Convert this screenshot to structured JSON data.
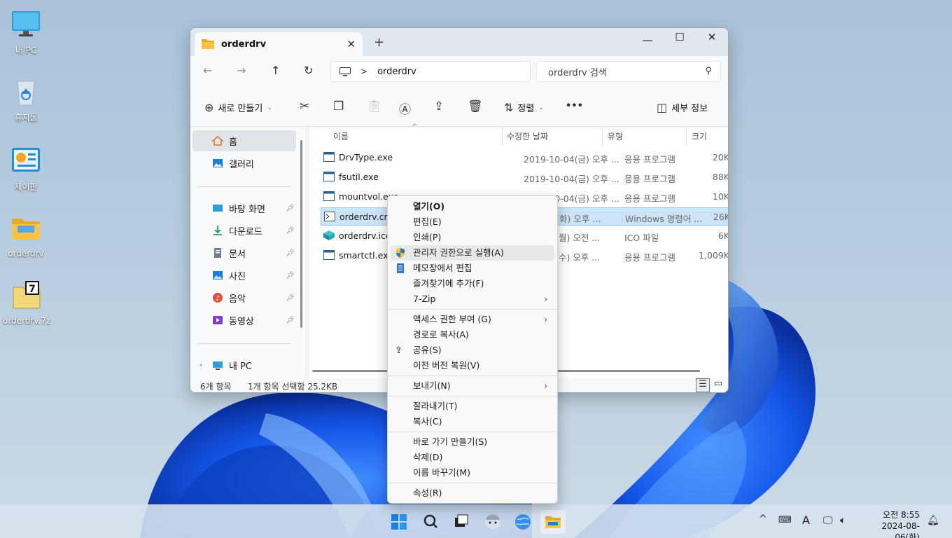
{
  "desktop": {
    "icons": [
      {
        "label": "내 PC",
        "icon": "monitor-icon"
      },
      {
        "label": "휴지통",
        "icon": "recycle-bin-icon"
      },
      {
        "label": "제어판",
        "icon": "control-panel-icon"
      },
      {
        "label": "orderdrv",
        "icon": "folder-icon"
      },
      {
        "label": "orderdrv.7z",
        "icon": "7zip-archive-icon"
      }
    ]
  },
  "window": {
    "tab_title": "orderdrv",
    "close_tab": "✕",
    "new_tab": "+",
    "minimize": "—",
    "maximize": "☐",
    "close": "✕"
  },
  "navbar": {
    "back": "←",
    "forward": "→",
    "up": "↑",
    "refresh": "↻",
    "path_sep": ">",
    "path": "orderdrv",
    "search_placeholder": "orderdrv 검색"
  },
  "toolbar": {
    "new_label": "새로 만들기",
    "sort_label": "정렬",
    "more": "•••",
    "details_label": "세부 정보"
  },
  "sidebar": {
    "items": [
      {
        "label": "홈",
        "icon": "home-icon"
      },
      {
        "label": "갤러리",
        "icon": "gallery-icon"
      },
      {
        "label": "바탕 화면",
        "icon": "desktop-icon"
      },
      {
        "label": "다운로드",
        "icon": "download-icon"
      },
      {
        "label": "문서",
        "icon": "documents-icon"
      },
      {
        "label": "사진",
        "icon": "pictures-icon"
      },
      {
        "label": "음악",
        "icon": "music-icon"
      },
      {
        "label": "동영상",
        "icon": "videos-icon"
      },
      {
        "label": "내 PC",
        "icon": "this-pc-icon"
      }
    ]
  },
  "files": {
    "columns": [
      "이름",
      "수정한 날짜",
      "유형",
      "크기"
    ],
    "rows": [
      {
        "name": "DrvType.exe",
        "date": "2019-10-04(금) 오후 ...",
        "type": "응용 프로그램",
        "size": "20K"
      },
      {
        "name": "fsutil.exe",
        "date": "2019-10-04(금) 오후 ...",
        "type": "응용 프로그램",
        "size": "88K"
      },
      {
        "name": "mountvol.exe",
        "date": "2019-10-04(금) 오후 ...",
        "type": "응용 프로그램",
        "size": "10K"
      },
      {
        "name": "orderdrv.cmd",
        "date": "화) 오후 ...",
        "type": "Windows 명령어 ...",
        "size": "26K"
      },
      {
        "name": "orderdrv.ico",
        "date": "월) 오전 ...",
        "type": "ICO 파일",
        "size": "6K"
      },
      {
        "name": "smartctl.exe",
        "date": "수) 오후 ...",
        "type": "응용 프로그램",
        "size": "1,009K"
      }
    ]
  },
  "statusbar": {
    "count": "6개 항목",
    "selection": "1개 항목 선택함 25.2KB"
  },
  "context_menu": {
    "items": [
      {
        "label": "열기(O)"
      },
      {
        "label": "편집(E)"
      },
      {
        "label": "인쇄(P)"
      },
      {
        "label": "관리자 권한으로 실행(A)",
        "icon": "uac-shield-icon"
      },
      {
        "label": "메모장에서 편집",
        "icon": "notepad-icon"
      },
      {
        "label": "즐겨찾기에 추가(F)"
      },
      {
        "label": "7-Zip"
      },
      {
        "label": "액세스 권한 부여 (G)"
      },
      {
        "label": "경로로 복사(A)"
      },
      {
        "label": "공유(S)",
        "icon": "share-icon"
      },
      {
        "label": "이전 버전 복원(V)"
      },
      {
        "label": "보내기(N)"
      },
      {
        "label": "잘라내기(T)"
      },
      {
        "label": "복사(C)"
      },
      {
        "label": "바로 가기 만들기(S)"
      },
      {
        "label": "삭제(D)"
      },
      {
        "label": "이름 바꾸기(M)"
      },
      {
        "label": "속성(R)"
      }
    ],
    "submenu_arrow": "›"
  },
  "taskbar": {
    "time": "오전 8:55",
    "date": "2024-08-06(화)",
    "ime": "A",
    "tray_up": "^"
  },
  "colors": {
    "selection_bg": "#cce4f7",
    "accent": "#0067c0",
    "folder_yellow": "#f6c344"
  }
}
